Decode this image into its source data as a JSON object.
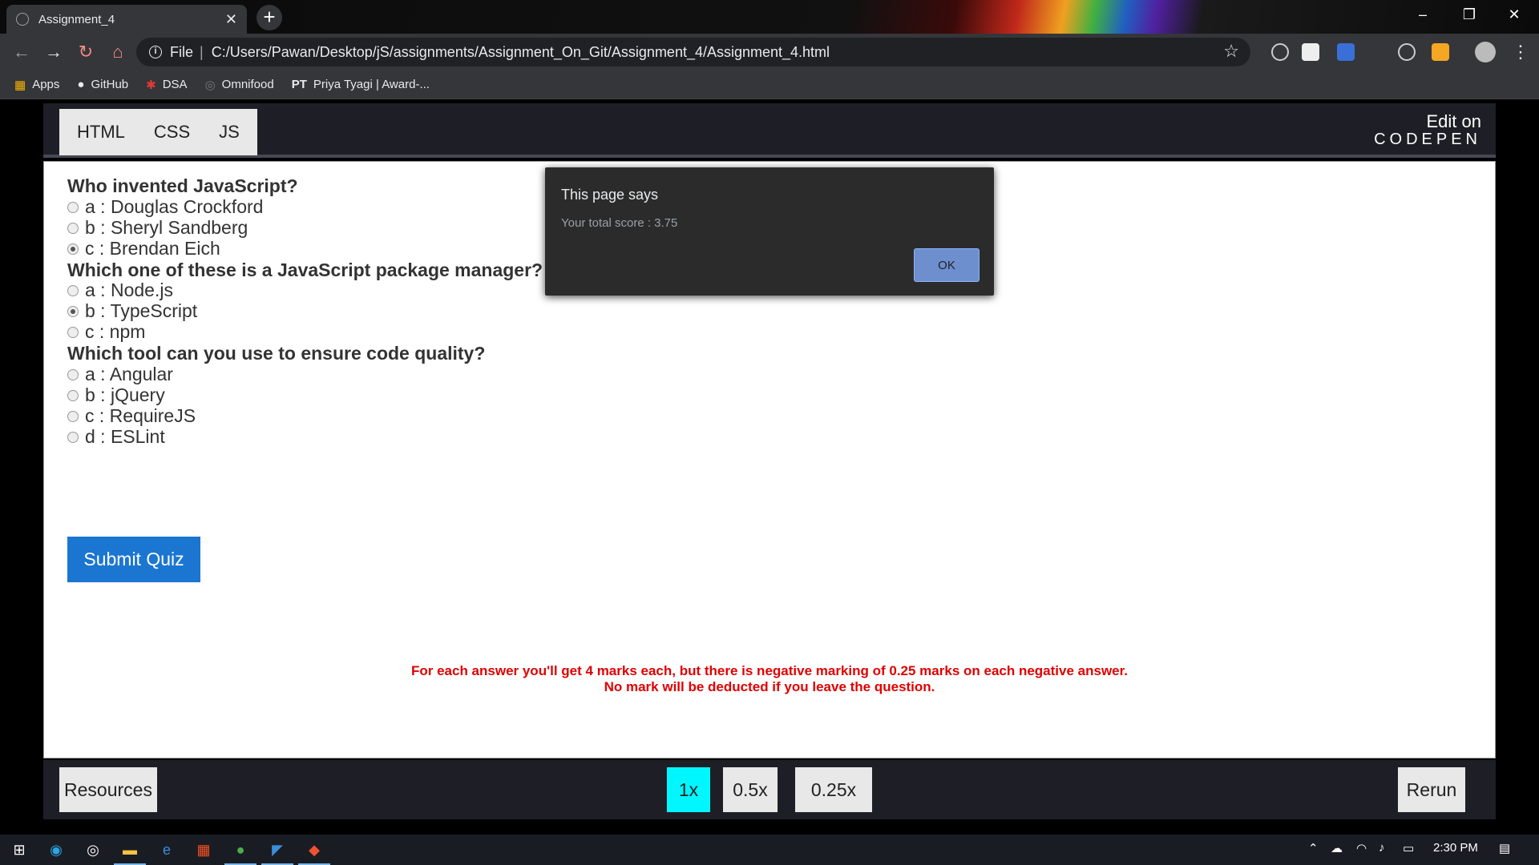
{
  "browser": {
    "tab_title": "Assignment_4",
    "file_label": "File",
    "url": "C:/Users/Pawan/Desktop/jS/assignments/Assignment_On_Git/Assignment_4/Assignment_4.html",
    "bookmarks": [
      {
        "label": "Apps",
        "icon": "apps-grid-icon"
      },
      {
        "label": "GitHub",
        "icon": "github-icon"
      },
      {
        "label": "DSA",
        "icon": "dsa-icon"
      },
      {
        "label": "Omnifood",
        "icon": "omnifood-icon"
      },
      {
        "label": "Priya Tyagi | Award-...",
        "icon": "pt-icon"
      }
    ]
  },
  "codepen": {
    "tabs": [
      "HTML",
      "CSS",
      "JS"
    ],
    "edit_on": "Edit on",
    "brand": "CODEPEN",
    "bottom": {
      "resources": "Resources",
      "speeds": [
        "1x",
        "0.5x",
        "0.25x"
      ],
      "active_speed": "1x",
      "rerun": "Rerun"
    }
  },
  "quiz": {
    "questions": [
      {
        "text": "Who invented JavaScript?",
        "options": [
          "a : Douglas Crockford",
          "b : Sheryl Sandberg",
          "c : Brendan Eich"
        ],
        "selected": 2
      },
      {
        "text": "Which one of these is a JavaScript package manager?",
        "options": [
          "a : Node.js",
          "b : TypeScript",
          "c : npm"
        ],
        "selected": 1
      },
      {
        "text": "Which tool can you use to ensure code quality?",
        "options": [
          "a : Angular",
          "b : jQuery",
          "c : RequireJS",
          "d : ESLint"
        ],
        "selected": null
      }
    ],
    "submit_label": "Submit Quiz",
    "note_line1": "For each answer you'll get 4 marks each, but there is negative marking of 0.25 marks on each negative answer.",
    "note_line2": "No mark will be deducted if you leave the question."
  },
  "alert": {
    "title": "This page says",
    "message": "Your total score : 3.75",
    "ok_label": "OK"
  },
  "taskbar": {
    "time": "2:30 PM"
  },
  "colors": {
    "submit": "#1b76d2",
    "active_speed": "#00f7ff",
    "note": "#e10000"
  }
}
